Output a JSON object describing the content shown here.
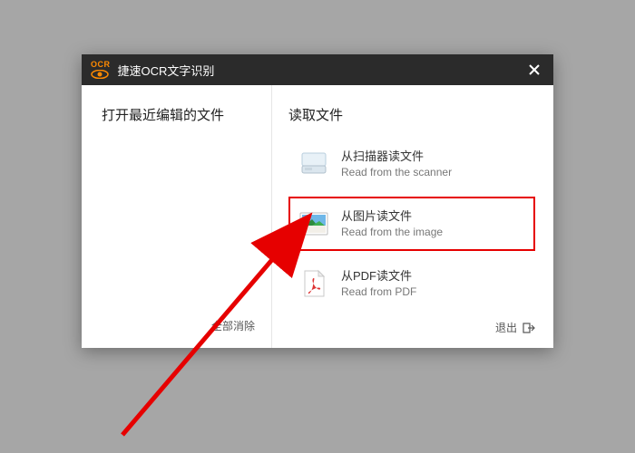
{
  "titlebar": {
    "ocr_badge": "OCR",
    "title": "捷速OCR文字识别"
  },
  "left": {
    "heading": "打开最近编辑的文件",
    "clear_all": "全部消除"
  },
  "right": {
    "heading": "读取文件",
    "options": [
      {
        "zh": "从扫描器读文件",
        "en": "Read from the scanner"
      },
      {
        "zh": "从图片读文件",
        "en": "Read from the image"
      },
      {
        "zh": "从PDF读文件",
        "en": "Read from PDF"
      }
    ],
    "exit": "退出"
  }
}
